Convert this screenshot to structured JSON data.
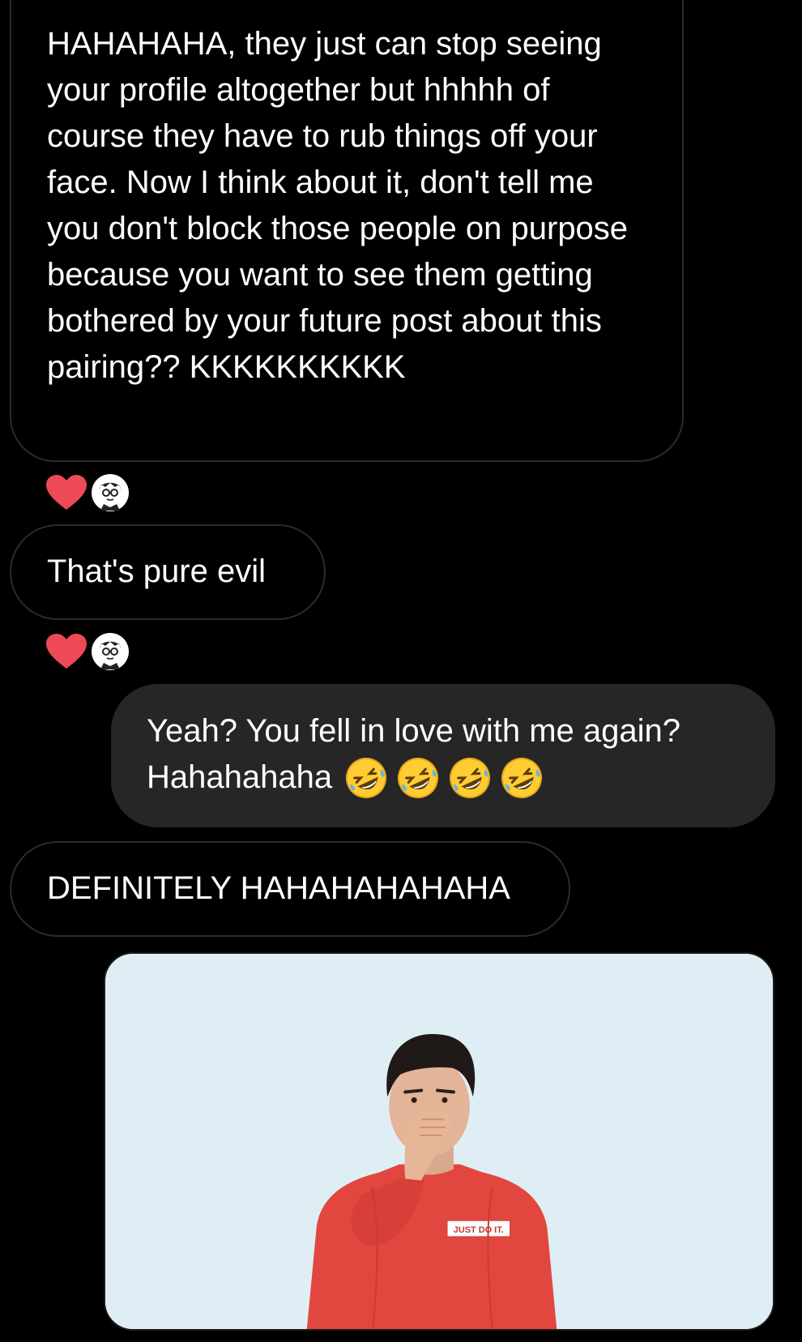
{
  "messages": [
    {
      "id": "msg1",
      "sender": "them",
      "text": "HAHAHAHA, they just can stop seeing your profile altogether but hhhhh of course they have to rub things off your face. Now I think about it, don't tell me you don't block those people on purpose because you want to see them getting bothered by your future post about this pairing?? KKKKKKKKKK"
    },
    {
      "id": "msg2",
      "sender": "them",
      "text": "That's pure evil"
    },
    {
      "id": "msg3",
      "sender": "me",
      "line1": "Yeah? You fell in love with me again?",
      "line2": "Hahahahaha",
      "emoji": [
        "rofl-emoji",
        "rofl-emoji",
        "rofl-emoji",
        "rofl-emoji"
      ]
    },
    {
      "id": "msg4",
      "sender": "them",
      "text": "DEFINITELY HAHAHAHAHAHA"
    }
  ],
  "reactions": [
    {
      "emoji": "heart-icon",
      "color": "#ed4956"
    },
    {
      "emoji": "heart-icon",
      "color": "#ed4956"
    }
  ],
  "gif": {
    "shirt_text": "JUST DO IT."
  },
  "colors": {
    "background": "#000000",
    "outgoing_bubble": "#262626",
    "incoming_border": "#2b2b2b",
    "heart": "#ed4956"
  }
}
